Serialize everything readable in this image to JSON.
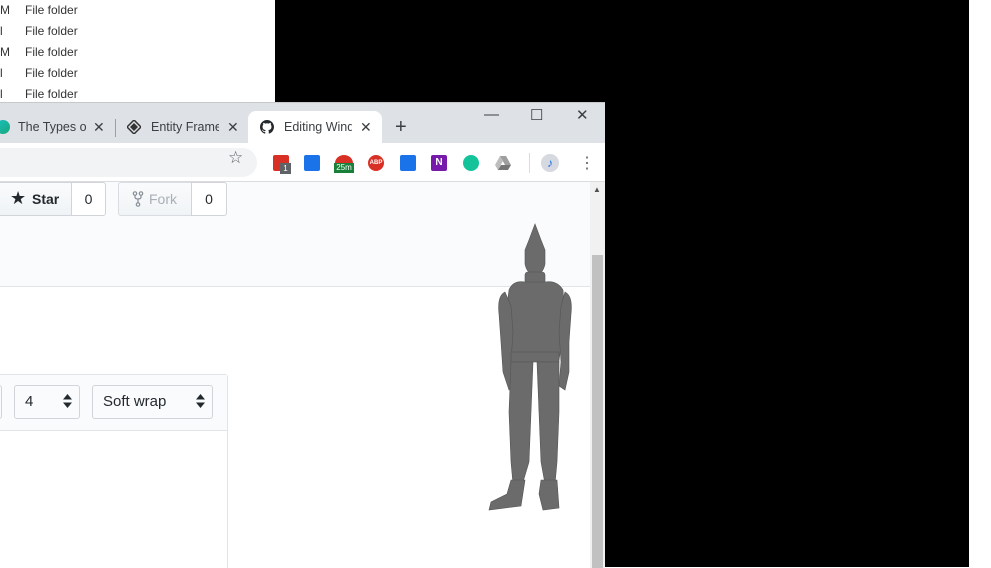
{
  "explorer": {
    "rows": [
      {
        "cut": "M",
        "type": "File folder"
      },
      {
        "cut": "l",
        "type": "File folder"
      },
      {
        "cut": "M",
        "type": "File folder"
      },
      {
        "cut": "l",
        "type": "File folder"
      },
      {
        "cut": "l",
        "type": "File folder"
      }
    ]
  },
  "browser": {
    "tabs": [
      {
        "title": "The Types of",
        "close": "✕"
      },
      {
        "title": "Entity Frame",
        "close": "✕"
      },
      {
        "title": "Editing Wind",
        "close": "✕"
      }
    ],
    "newtab": "+",
    "window_controls": {
      "minimize": "—",
      "maximize": "☐",
      "close": "✕"
    },
    "extensions": {
      "calendar_badge": "1",
      "timer_badge": "25m",
      "abp": "ABP",
      "onenote": "N"
    }
  },
  "repo": {
    "star_label": "Star",
    "star_count": "0",
    "fork_label": "Fork",
    "fork_count": "0"
  },
  "editor": {
    "indent_size": "4",
    "wrap_mode": "Soft wrap"
  },
  "colors": {
    "tabstrip": "#dee1e6",
    "github_bg": "#fafbfc",
    "figure": "#6b6b6b"
  }
}
